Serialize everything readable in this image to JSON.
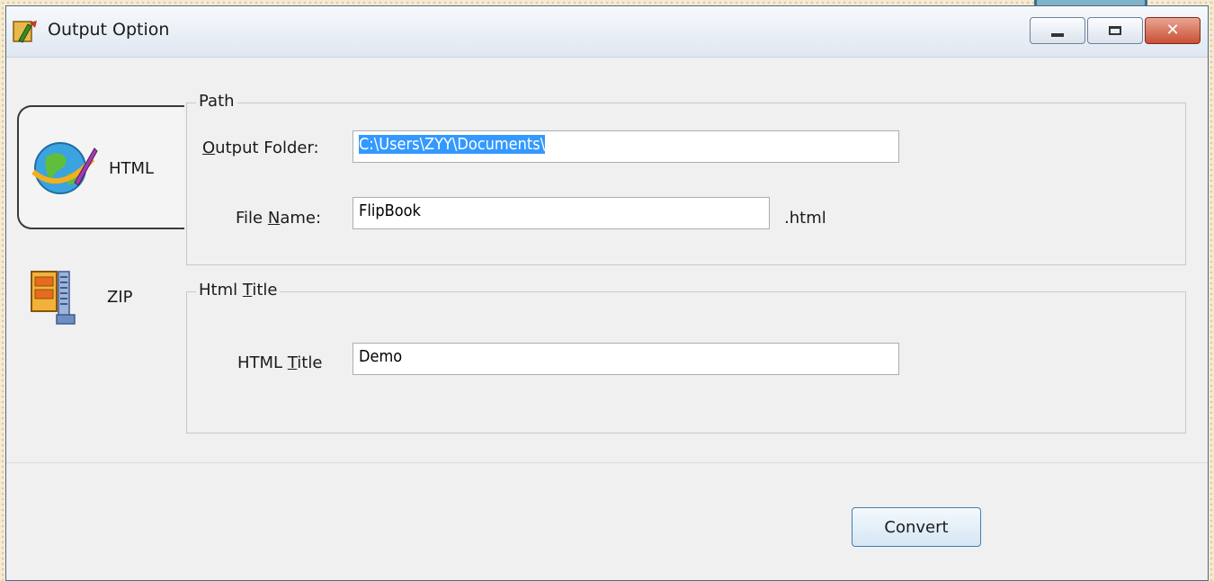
{
  "window": {
    "title": "Output Option",
    "accent": "#4a6a8a"
  },
  "sidebar": {
    "items": [
      {
        "label": "HTML",
        "icon": "globe-icon",
        "selected": true
      },
      {
        "label": "ZIP",
        "icon": "zip-archive-icon",
        "selected": false
      }
    ]
  },
  "path_group": {
    "legend": "Path",
    "output_folder": {
      "label_pre": "",
      "label_u": "O",
      "label_post": "utput Folder:",
      "value": "C:\\Users\\ZYY\\Documents\\"
    },
    "file_name": {
      "label_pre": "File ",
      "label_u": "N",
      "label_post": "ame:",
      "value": "FlipBook",
      "suffix": ".html"
    }
  },
  "title_group": {
    "legend_pre": "Html ",
    "legend_u": "T",
    "legend_post": "itle",
    "html_title": {
      "label_pre": "HTML ",
      "label_u": "T",
      "label_post": "itle",
      "value": "Demo"
    }
  },
  "footer": {
    "convert_label": "Convert"
  }
}
